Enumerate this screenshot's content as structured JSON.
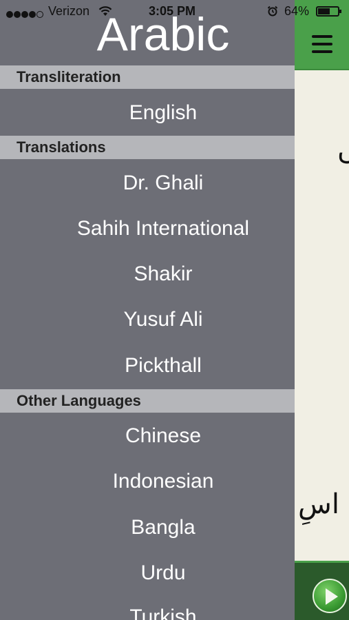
{
  "status_bar": {
    "carrier": "Verizon",
    "time": "3:05 PM",
    "battery_percent": "64%",
    "battery_level": 0.64,
    "signal_bars": 4,
    "signal_max": 5
  },
  "menu": {
    "title": "Arabic",
    "sections": [
      {
        "header": "Transliteration",
        "items": [
          "English"
        ]
      },
      {
        "header": "Translations",
        "items": [
          "Dr. Ghali",
          "Sahih International",
          "Shakir",
          "Yusuf Ali",
          "Pickthall"
        ]
      },
      {
        "header": "Other Languages",
        "items": [
          "Chinese",
          "Indonesian",
          "Bangla",
          "Urdu",
          "Turkish"
        ]
      }
    ]
  },
  "main": {
    "arabic_fragment_1": "ں",
    "arabic_fragment_2": "اسِ",
    "icons": {
      "menu": "hamburger-icon",
      "play": "play-icon"
    }
  },
  "colors": {
    "menu_background": "#6d6e76",
    "section_header_background": "#b5b6ba",
    "top_bar_green": "#4aa04a",
    "page_background": "#f1efe4",
    "bottom_bar_green": "#2b5a2b"
  }
}
